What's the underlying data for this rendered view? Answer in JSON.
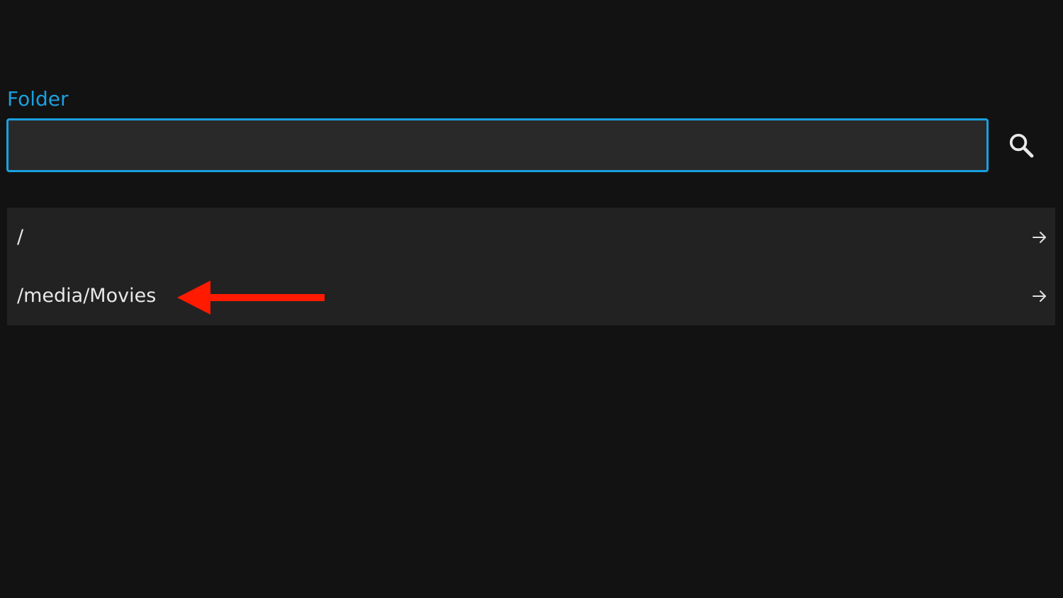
{
  "form": {
    "folder_label": "Folder",
    "folder_value": "",
    "search_icon": "search-icon"
  },
  "folders": {
    "items": [
      {
        "path": "/",
        "icon": "arrow-right-icon"
      },
      {
        "path": "/media/Movies",
        "icon": "arrow-right-icon"
      }
    ]
  },
  "annotation": {
    "icon": "red-arrow-annotation",
    "color": "#ff1a00"
  },
  "colors": {
    "accent": "#1aa0e0",
    "background": "#121212",
    "list_background": "#222222",
    "input_background": "#292929"
  }
}
